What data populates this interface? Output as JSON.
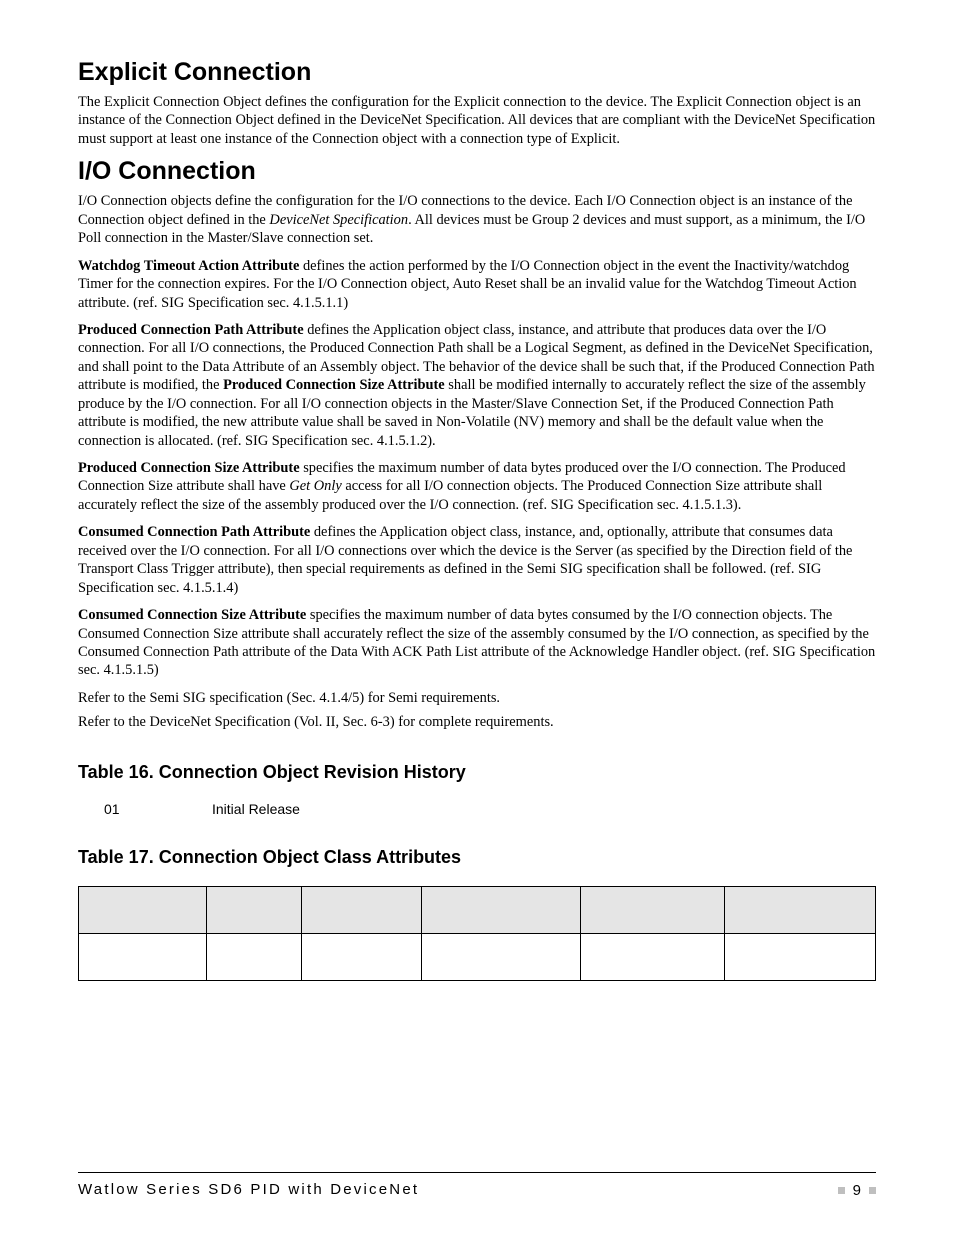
{
  "sections": {
    "explicit": {
      "heading": "Explicit Connection",
      "p1": "The Explicit Connection Object defines the configuration for the Explicit connection to the device. The Explicit Connection object is an instance of the Connection Object defined in the DeviceNet Specification. All devices that are compliant with the DeviceNet Specification must support at least one instance of the Connection object with a connection type of Explicit."
    },
    "io": {
      "heading": "I/O Connection",
      "p1a": "I/O Connection objects define the configuration for the I/O connections to the device. Each I/O Connection object is an instance of the Connection object defined in the ",
      "p1b": "DeviceNet Specification",
      "p1c": ". All devices must be Group 2 devices and must support, as a minimum, the I/O Poll connection in the Master/Slave connection set.",
      "p2_lead": "Watchdog Timeout Action Attribute",
      "p2_rest": " defines the action performed by the I/O Connection object in the event the Inactivity/watchdog Timer for the connection expires. For the I/O Connection object, Auto Reset shall be an invalid value for the Watchdog Timeout Action attribute. (ref. SIG Specification sec. 4.1.5.1.1)",
      "p3_lead": "Produced Connection Path Attribute",
      "p3_mid1": " defines the Application object class, instance, and attribute that produces data over the I/O connection. For all I/O connections, the Produced Connection Path shall be a Logical Segment, as defined in the DeviceNet Specification, and shall point to the Data Attribute of an Assembly object. The behavior of the device shall be such that, if the Produced Connection Path attribute is modified, the ",
      "p3_bold2": "Produced Connection Size Attribute",
      "p3_mid2": " shall be modified internally to accurately reflect the size of the assembly produce by the I/O connection. For all I/O connection objects in the Master/Slave Connection Set, if the Produced Connection Path attribute is modified, the new attribute value shall be saved in Non-Volatile (NV) memory and shall be the default value when the connection is allocated. (ref. SIG Specification sec. 4.1.5.1.2).",
      "p4_lead": "Produced Connection Size Attribute",
      "p4_mid1": " specifies the maximum number of data bytes produced over the I/O connection. The Produced Connection Size attribute shall have ",
      "p4_ital": "Get Only",
      "p4_mid2": " access for all I/O connection objects. The Produced Connection Size attribute shall accurately reflect the size of the assembly produced over the I/O connection. (ref. SIG Specification sec. 4.1.5.1.3).",
      "p5_lead": "Consumed Connection Path Attribute",
      "p5_rest": " defines the Application object class, instance, and, optionally, attribute that consumes data received over the I/O connection. For all I/O connections over which the device is the Server (as specified by the Direction field of the Transport Class Trigger attribute), then special requirements as defined in the Semi SIG specification shall be followed. (ref. SIG Specification sec. 4.1.5.1.4)",
      "p6_lead": "Consumed Connection Size Attribute",
      "p6_rest": " specifies the maximum number of data bytes consumed by the I/O connection objects. The Consumed Connection Size attribute shall accurately reflect the size of the assembly consumed by the I/O connection, as specified by the Consumed Connection Path attribute of the Data With ACK Path List attribute of the Acknowledge Handler object. (ref. SIG Specification sec. 4.1.5.1.5)",
      "p7": "Refer to the Semi SIG specification (Sec. 4.1.4/5) for Semi requirements.",
      "p8": "Refer to the DeviceNet Specification (Vol. II, Sec. 6-3) for complete requirements."
    }
  },
  "tables": {
    "t16": {
      "title": "Table 16. Connection Object Revision History",
      "rows": [
        {
          "rev": "01",
          "desc": "Initial Release"
        }
      ]
    },
    "t17": {
      "title": "Table 17. Connection Object Class Attributes",
      "headers": [
        "",
        "",
        "",
        "",
        "",
        ""
      ],
      "rows": [
        [
          "",
          "",
          "",
          "",
          "",
          ""
        ]
      ]
    }
  },
  "footer": {
    "left": "Watlow Series SD6 PID with DeviceNet",
    "page": "9"
  }
}
